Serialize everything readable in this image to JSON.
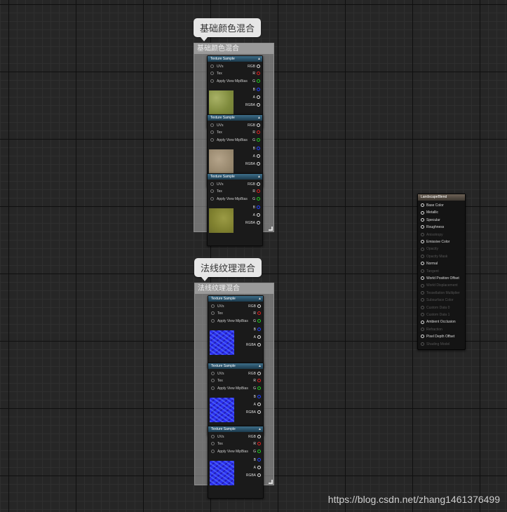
{
  "comments": [
    {
      "bubble": "基础颜色混合",
      "header": "基础颜色混合"
    },
    {
      "bubble": "法线纹理混合",
      "header": "法线纹理混合"
    }
  ],
  "texture_node": {
    "title": "Texture Sample",
    "collapse_icon": "triangle-up-icon",
    "inputs": [
      "UVs",
      "Tex",
      "Apply View MipBias"
    ],
    "outputs": [
      "RGB",
      "R",
      "G",
      "B",
      "A",
      "RGBA"
    ],
    "output_colors": [
      "#dddddd",
      "#e02020",
      "#20d020",
      "#2040ff",
      "#dddddd",
      "#dddddd"
    ]
  },
  "blend_node": {
    "title": "LandscapeBlend",
    "pins": [
      {
        "label": "Base Color",
        "enabled": true
      },
      {
        "label": "Metallic",
        "enabled": true
      },
      {
        "label": "Specular",
        "enabled": true
      },
      {
        "label": "Roughness",
        "enabled": true
      },
      {
        "label": "Anisotropy",
        "enabled": false
      },
      {
        "label": "Emissive Color",
        "enabled": true
      },
      {
        "label": "Opacity",
        "enabled": false
      },
      {
        "label": "Opacity Mask",
        "enabled": false
      },
      {
        "label": "Normal",
        "enabled": true
      },
      {
        "label": "Tangent",
        "enabled": false
      },
      {
        "label": "World Position Offset",
        "enabled": true
      },
      {
        "label": "World Displacement",
        "enabled": false
      },
      {
        "label": "Tessellation Multiplier",
        "enabled": false
      },
      {
        "label": "Subsurface Color",
        "enabled": false
      },
      {
        "label": "Custom Data 0",
        "enabled": false
      },
      {
        "label": "Custom Data 1",
        "enabled": false
      },
      {
        "label": "Ambient Occlusion",
        "enabled": true
      },
      {
        "label": "Refraction",
        "enabled": false
      },
      {
        "label": "Pixel Depth Offset",
        "enabled": true
      },
      {
        "label": "Shading Model",
        "enabled": false
      }
    ]
  },
  "watermark": "https://blog.csdn.net/zhang1461376499"
}
